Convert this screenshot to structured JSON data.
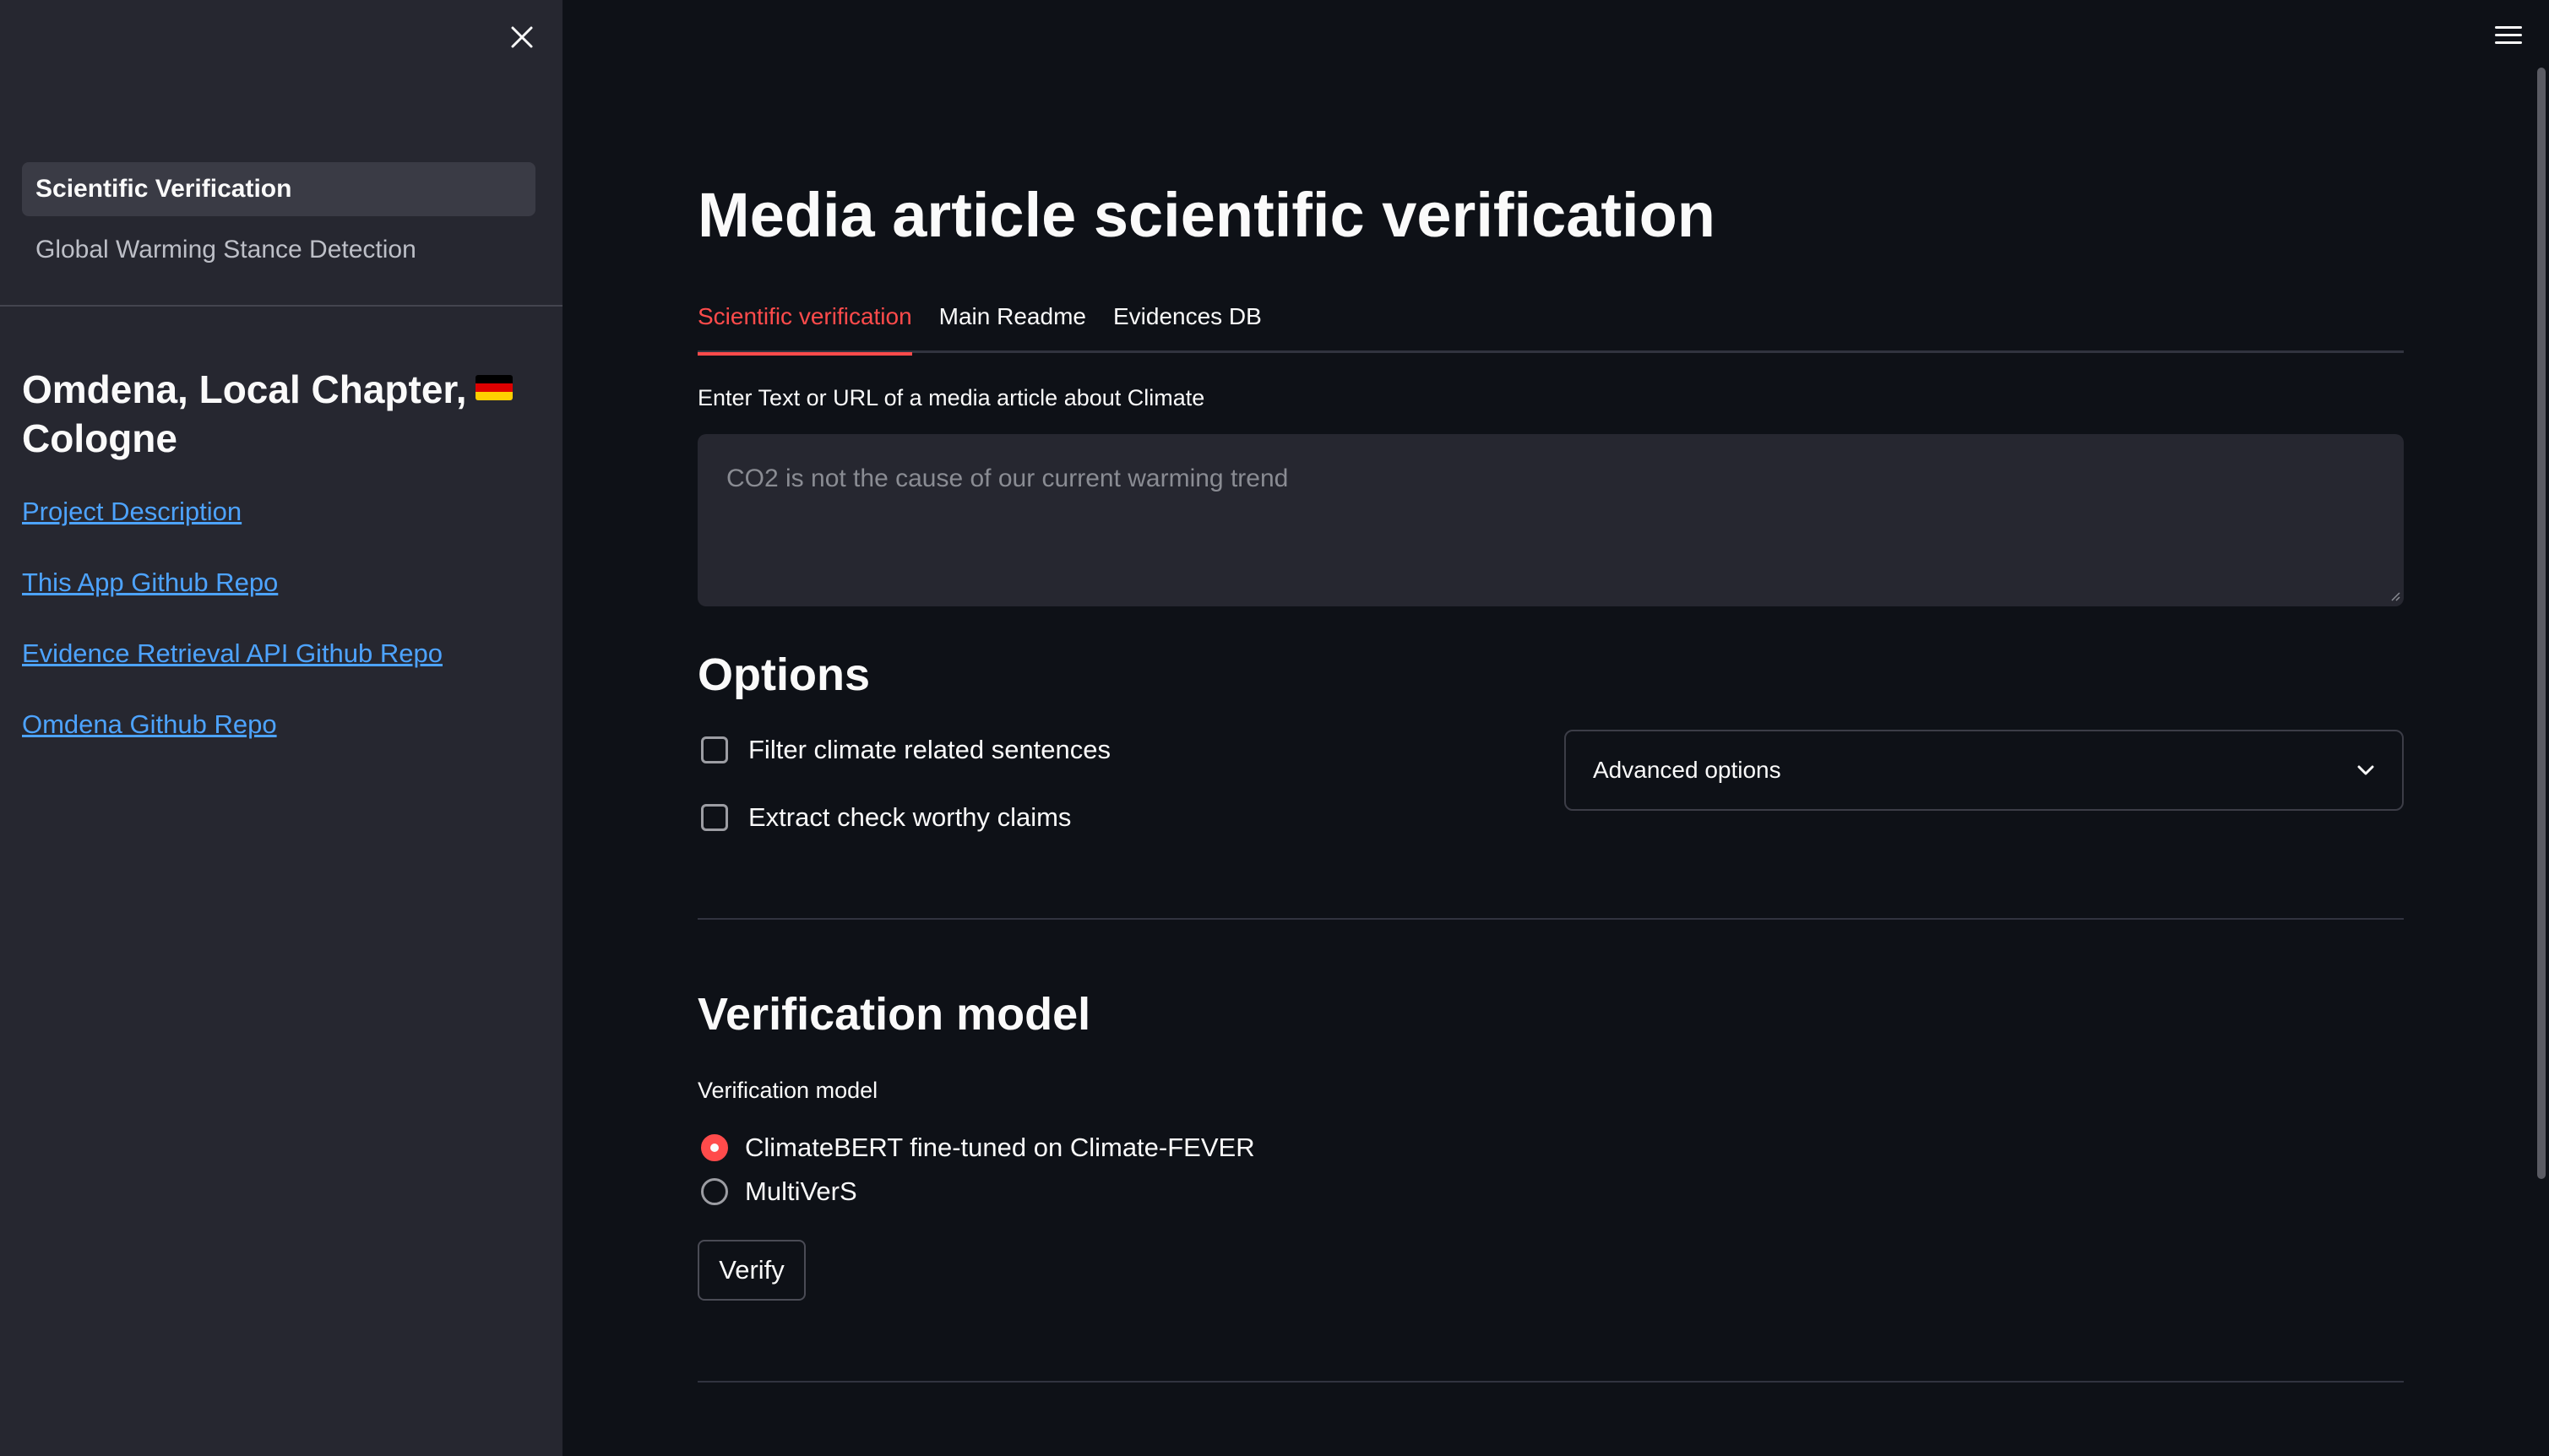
{
  "sidebar": {
    "nav": [
      {
        "label": "Scientific Verification",
        "active": true
      },
      {
        "label": "Global Warming Stance Detection",
        "active": false
      }
    ],
    "heading_line1": "Omdena, Local Chapter,",
    "heading_line2": "Cologne",
    "flag_icon": "germany-flag-icon",
    "links": [
      "Project Description",
      "This App Github Repo",
      "Evidence Retrieval API Github Repo",
      "Omdena Github Repo"
    ]
  },
  "main": {
    "title": "Media article scientific verification",
    "tabs": [
      {
        "label": "Scientific verification",
        "active": true
      },
      {
        "label": "Main Readme",
        "active": false
      },
      {
        "label": "Evidences DB",
        "active": false
      }
    ],
    "input_label": "Enter Text or URL of a media article about Climate",
    "input_placeholder": "CO2 is not the cause of our current warming trend",
    "options_title": "Options",
    "checkboxes": [
      {
        "label": "Filter climate related sentences",
        "checked": false
      },
      {
        "label": "Extract check worthy claims",
        "checked": false
      }
    ],
    "expander_label": "Advanced options",
    "verification_title": "Verification model",
    "radio_label": "Verification model",
    "radio_options": [
      {
        "label": "ClimateBERT fine-tuned on Climate-FEVER",
        "checked": true
      },
      {
        "label": "MultiVerS",
        "checked": false
      }
    ],
    "verify_label": "Verify"
  },
  "colors": {
    "background": "#0e1117",
    "sidebar": "#262730",
    "accent": "#ff4b4b",
    "link": "#4da3ff"
  },
  "icons": {
    "close": "close-icon",
    "menu": "hamburger-menu-icon",
    "chevron": "chevron-down-icon"
  }
}
